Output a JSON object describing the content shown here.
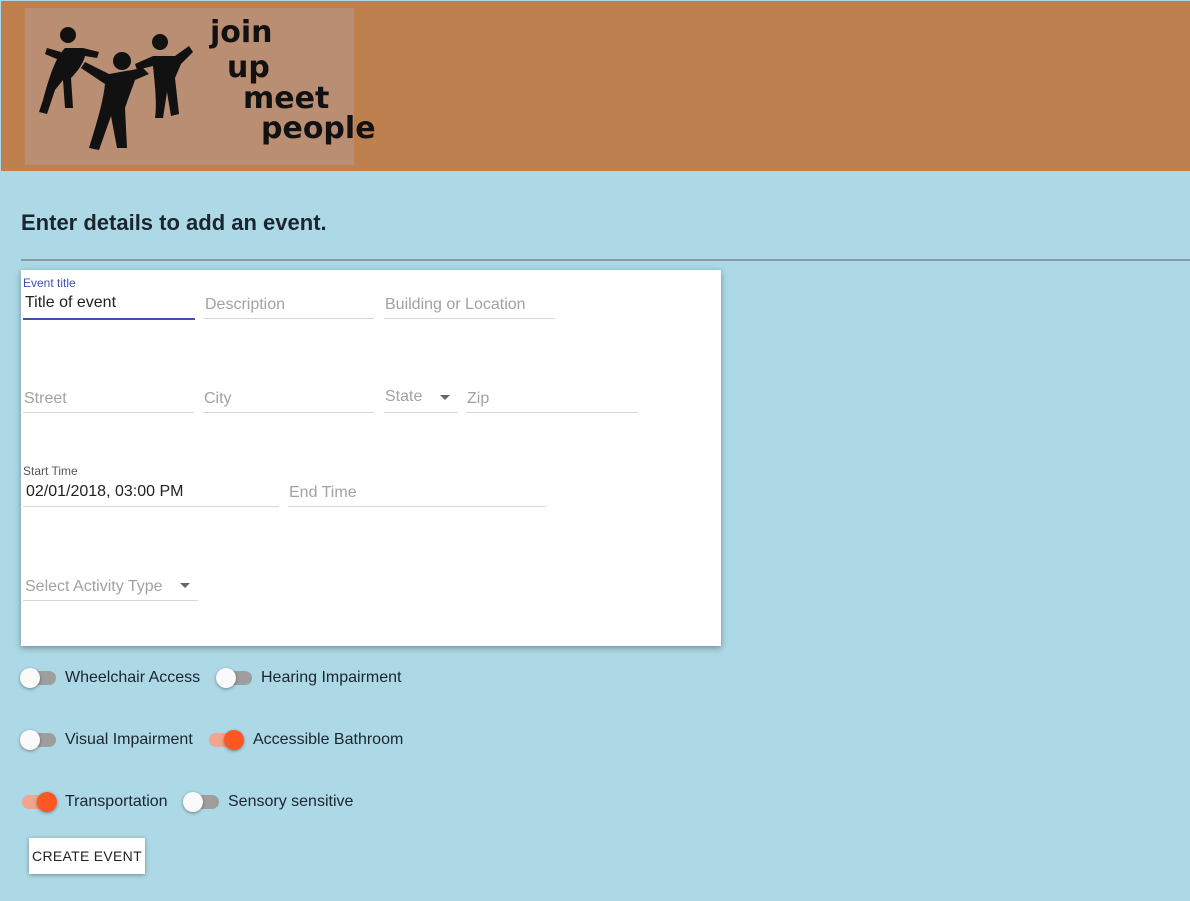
{
  "header": {
    "logo": {
      "lines": [
        "join",
        "up",
        "meet",
        "people"
      ]
    },
    "background": "#bf8050"
  },
  "page": {
    "title": "Enter details to add an event."
  },
  "form": {
    "event_title": {
      "label": "Event title",
      "value": "Title of event"
    },
    "description": {
      "placeholder": "Description"
    },
    "location": {
      "placeholder": "Building or Location"
    },
    "street": {
      "placeholder": "Street"
    },
    "city": {
      "placeholder": "City"
    },
    "state": {
      "placeholder": "State"
    },
    "zip": {
      "placeholder": "Zip"
    },
    "start_time": {
      "label": "Start Time",
      "value": "02/01/2018, 03:00 PM"
    },
    "end_time": {
      "placeholder": "End Time"
    },
    "activity_type": {
      "placeholder": "Select Activity Type"
    }
  },
  "toggles": [
    {
      "label": "Wheelchair Access",
      "on": false
    },
    {
      "label": "Hearing Impairment",
      "on": false
    },
    {
      "label": "Visual Impairment",
      "on": false
    },
    {
      "label": "Accessible Bathroom",
      "on": true
    },
    {
      "label": "Transportation",
      "on": true
    },
    {
      "label": "Sensory sensitive",
      "on": false
    }
  ],
  "actions": {
    "create_label": "CREATE EVENT"
  },
  "colors": {
    "accent": "#ff5722",
    "focus": "#3f51b5",
    "page_bg": "#add8e6"
  }
}
